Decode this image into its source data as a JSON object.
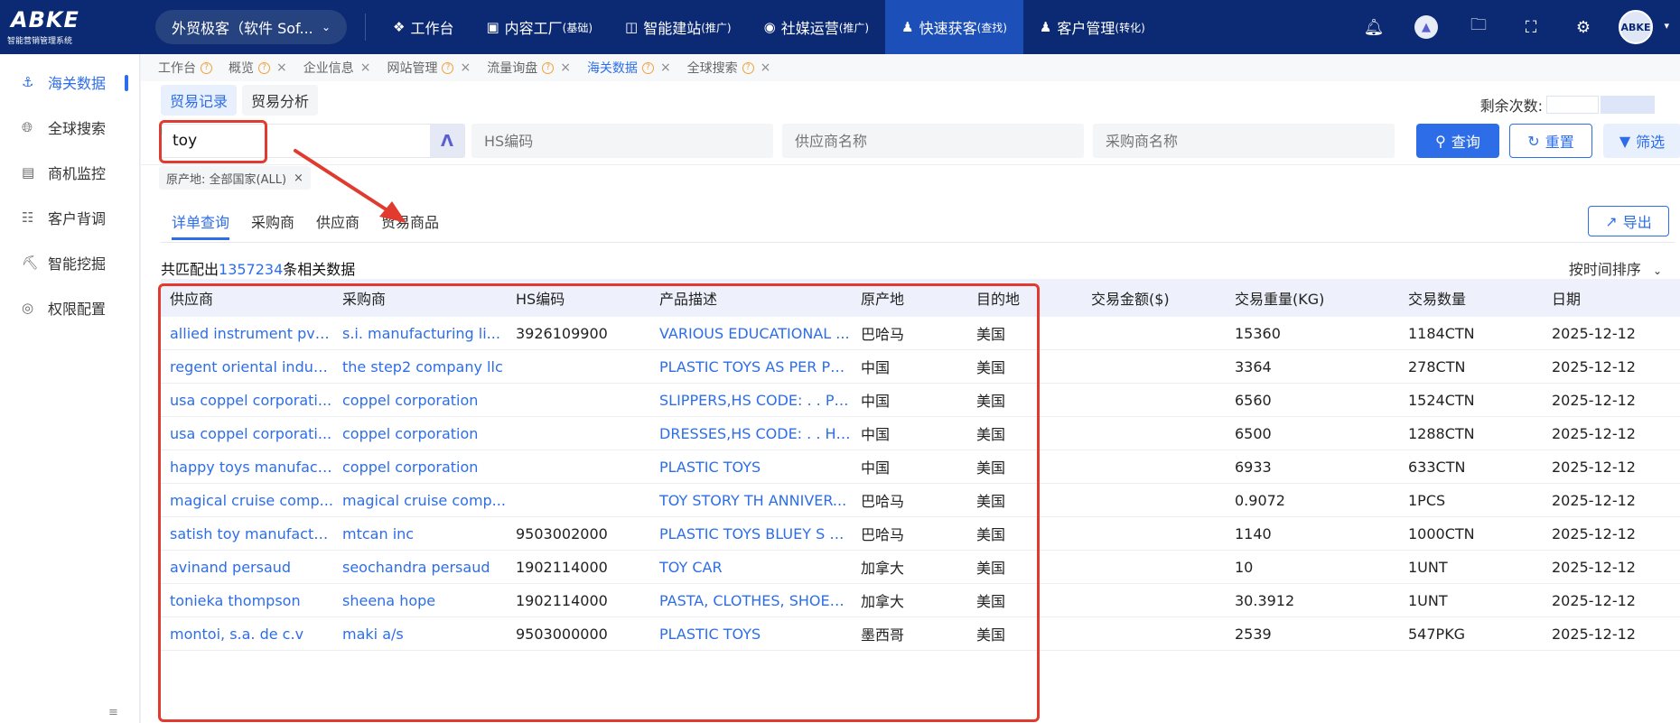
{
  "logo": {
    "mark": "ABKE",
    "subtitle": "智能营销管理系统"
  },
  "app_selector": {
    "label": "外贸极客（软件 Sof..."
  },
  "nav": [
    {
      "icon": "cube-icon",
      "label": "工作台",
      "note": ""
    },
    {
      "icon": "book-icon",
      "label": "内容工厂",
      "note": "(基础)"
    },
    {
      "icon": "website-icon",
      "label": "智能建站",
      "note": "(推广)"
    },
    {
      "icon": "social-icon",
      "label": "社媒运营",
      "note": "(推广)"
    },
    {
      "icon": "user-icon",
      "label": "快速获客",
      "note": "(查找)"
    },
    {
      "icon": "users-icon",
      "label": "客户管理",
      "note": "(转化)"
    }
  ],
  "sidebar": [
    {
      "icon": "anchor-icon",
      "label": "海关数据"
    },
    {
      "icon": "globe-search-icon",
      "label": "全球搜索"
    },
    {
      "icon": "chart-icon",
      "label": "商机监控"
    },
    {
      "icon": "document-icon",
      "label": "客户背调"
    },
    {
      "icon": "mining-icon",
      "label": "智能挖掘"
    },
    {
      "icon": "target-icon",
      "label": "权限配置"
    }
  ],
  "tabs": [
    {
      "label": "工作台",
      "closable": false
    },
    {
      "label": "概览",
      "closable": true
    },
    {
      "label": "企业信息",
      "closable": true
    },
    {
      "label": "网站管理",
      "closable": true
    },
    {
      "label": "流量询盘",
      "closable": true
    },
    {
      "label": "海关数据",
      "closable": true
    },
    {
      "label": "全球搜索",
      "closable": true
    }
  ],
  "subtabs": {
    "records": "贸易记录",
    "analysis": "贸易分析"
  },
  "remaining_label": "剩余次数:",
  "search": {
    "keyword": "toy",
    "hs_placeholder": "HS编码",
    "supplier_placeholder": "供应商名称",
    "buyer_placeholder": "采购商名称",
    "query_label": "查询",
    "reset_label": "重置",
    "filter_label": "筛选"
  },
  "filter_chip": "原产地: 全部国家(ALL)",
  "query_tabs": [
    "详单查询",
    "采购商",
    "供应商",
    "贸易商品"
  ],
  "export_label": "导出",
  "match": {
    "prefix": "共匹配出",
    "count": "1357234",
    "suffix": "条相关数据"
  },
  "sort_label": "按时间排序",
  "table": {
    "headers": [
      "供应商",
      "采购商",
      "HS编码",
      "产品描述",
      "原产地",
      "目的地",
      "交易金额($)",
      "交易重量(KG)",
      "交易数量",
      "日期"
    ],
    "rows": [
      [
        "allied instrument pvt ...",
        "s.i. manufacturing li...",
        "3926109900",
        "VARIOUS EDUCATIONAL ...",
        "巴哈马",
        "美国",
        "",
        "15360",
        "1184CTN",
        "2025-12-12"
      ],
      [
        "regent oriental indus...",
        "the step2 company llc",
        "",
        "PLASTIC TOYS AS PER PO...",
        "中国",
        "美国",
        "",
        "3364",
        "278CTN",
        "2025-12-12"
      ],
      [
        "usa coppel corporati...",
        "coppel corporation",
        "",
        "SLIPPERS,HS CODE: . . PL...",
        "中国",
        "美国",
        "",
        "6560",
        "1524CTN",
        "2025-12-12"
      ],
      [
        "usa coppel corporati...",
        "coppel corporation",
        "",
        "DRESSES,HS CODE: . . HA...",
        "中国",
        "美国",
        "",
        "6500",
        "1288CTN",
        "2025-12-12"
      ],
      [
        "happy toys manufact...",
        "coppel corporation",
        "",
        "PLASTIC TOYS",
        "中国",
        "美国",
        "",
        "6933",
        "633CTN",
        "2025-12-12"
      ],
      [
        "magical cruise comp...",
        "magical cruise comp...",
        "",
        "TOY STORY TH ANNIVER...",
        "巴哈马",
        "美国",
        "",
        "0.9072",
        "1PCS",
        "2025-12-12"
      ],
      [
        "satish toy manufactu...",
        "mtcan inc",
        "9503002000",
        "PLASTIC TOYS BLUEY S R...",
        "巴哈马",
        "美国",
        "",
        "1140",
        "1000CTN",
        "2025-12-12"
      ],
      [
        "avinand persaud",
        "seochandra persaud",
        "1902114000",
        "TOY CAR",
        "加拿大",
        "美国",
        "",
        "10",
        "1UNT",
        "2025-12-12"
      ],
      [
        "tonieka thompson",
        "sheena hope",
        "1902114000",
        "PASTA, CLOTHES, SHOES,...",
        "加拿大",
        "美国",
        "",
        "30.3912",
        "1UNT",
        "2025-12-12"
      ],
      [
        "montoi, s.a. de c.v",
        "maki a/s",
        "9503000000",
        "PLASTIC TOYS",
        "墨西哥",
        "美国",
        "",
        "2539",
        "547PKG",
        "2025-12-12"
      ]
    ]
  },
  "colors": {
    "nav_bg": "#0b2a73",
    "accent": "#2d6ee8",
    "annotation": "#e03b2e"
  }
}
